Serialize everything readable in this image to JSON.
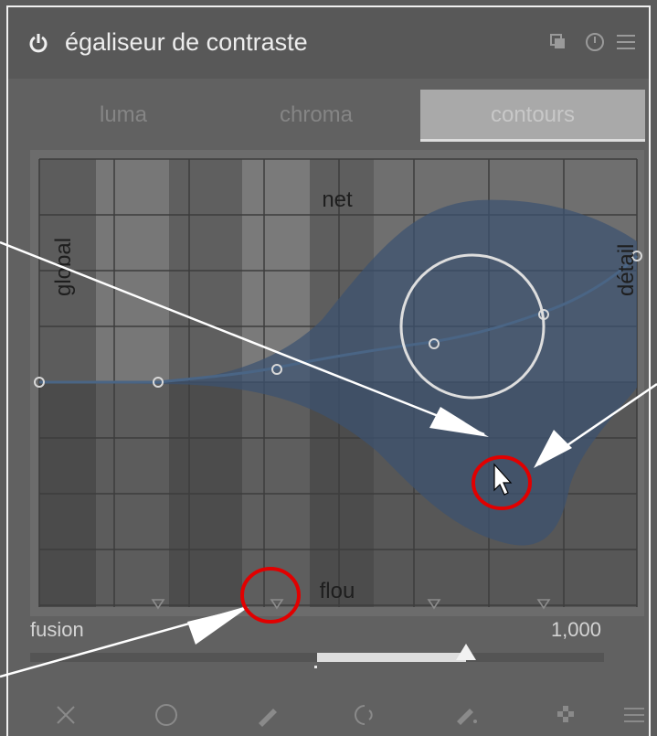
{
  "module": {
    "title": "égaliseur de contraste",
    "header_icons": [
      "power-icon",
      "multi-instance-icon",
      "reset-icon",
      "presets-menu-icon"
    ]
  },
  "tabs": [
    {
      "label": "luma",
      "active": false
    },
    {
      "label": "chroma",
      "active": false
    },
    {
      "label": "contours",
      "active": true
    }
  ],
  "graph": {
    "label_top": "net",
    "label_bottom": "flou",
    "label_left": "global",
    "label_right": "détail"
  },
  "fusion": {
    "label": "fusion",
    "value": "1,000",
    "level": 0.76
  },
  "toolbar": {
    "icons": [
      "close-icon",
      "circle-mask-icon",
      "brush-icon",
      "gradient-mask-icon",
      "drawn-parametric-icon",
      "mask-pattern-icon",
      "menu-icon"
    ]
  },
  "colors": {
    "accent_curve": "#4a5d78",
    "annotation_red": "#e10000",
    "annotation_arrow": "#ffffff"
  }
}
